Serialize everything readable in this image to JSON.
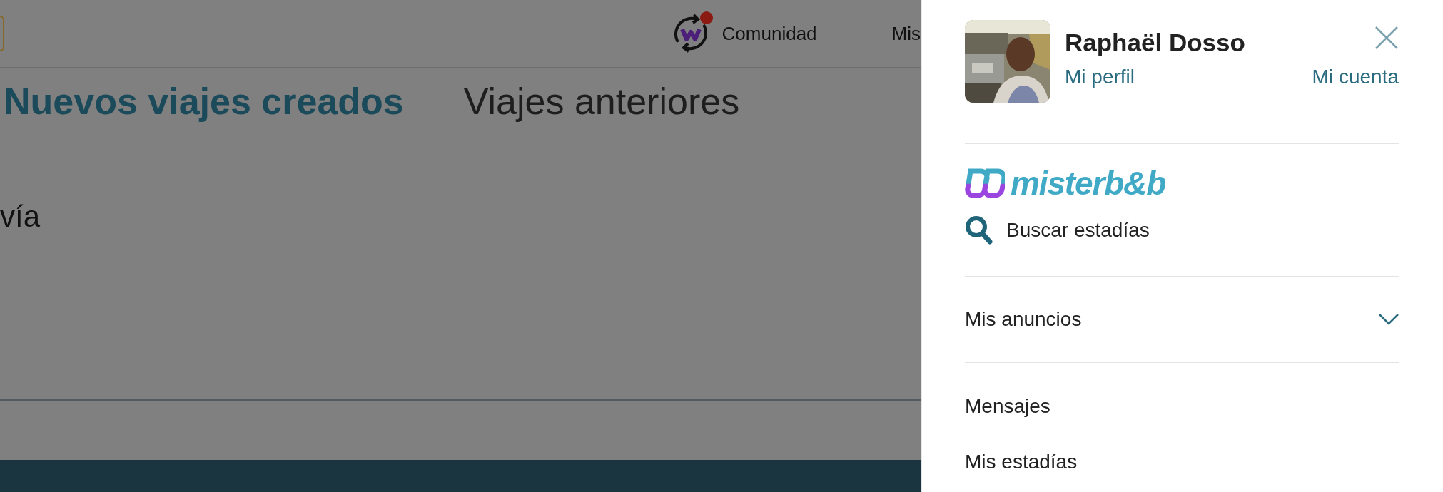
{
  "header": {
    "community_label": "Comunidad",
    "community_notification": true,
    "nav_label": "Mis"
  },
  "tabs": [
    {
      "label": "Nuevos viajes creados",
      "selected": true
    },
    {
      "label": "Viajes anteriores",
      "selected": false
    }
  ],
  "content_text": "vía",
  "panel": {
    "user_name": "Raphaël Dosso",
    "profile_link": "Mi perfil",
    "account_link": "Mi cuenta",
    "brand": "misterb&b",
    "search_label": "Buscar estadías",
    "menu": [
      {
        "label": "Mis anuncios",
        "kind": "expandable",
        "expanded": false
      },
      {
        "label": "Mensajes",
        "kind": "link"
      },
      {
        "label": "Mis estadías",
        "kind": "link"
      }
    ]
  }
}
